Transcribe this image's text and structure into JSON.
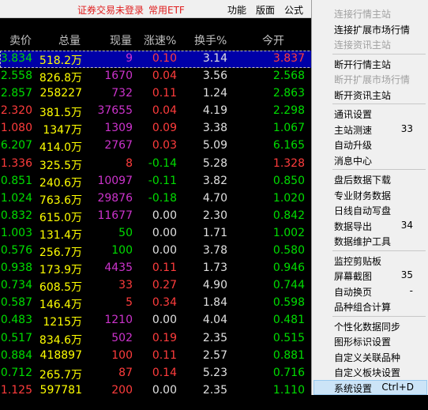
{
  "topbar": {
    "notice": "证券交易未登录",
    "etf": "常用ETF",
    "menus": [
      "功能",
      "版面",
      "公式"
    ]
  },
  "columns": [
    "卖价",
    "总量",
    "现量",
    "涨速%",
    "换手%",
    "今开"
  ],
  "rows": [
    {
      "price": "3.834",
      "vol": "518.2万",
      "now": "9",
      "spd": "0.10",
      "turn": "3.14",
      "open": "3.837",
      "pc": "down",
      "nc": "magenta",
      "sc": "up",
      "oc": "up"
    },
    {
      "price": "2.558",
      "vol": "826.8万",
      "now": "1670",
      "spd": "0.04",
      "turn": "3.56",
      "open": "2.568",
      "pc": "down",
      "nc": "magenta",
      "sc": "up",
      "oc": "down"
    },
    {
      "price": "2.857",
      "vol": "258227",
      "now": "732",
      "spd": "0.11",
      "turn": "1.24",
      "open": "2.863",
      "pc": "down",
      "nc": "magenta",
      "sc": "up",
      "oc": "down"
    },
    {
      "price": "2.320",
      "vol": "381.5万",
      "now": "37655",
      "spd": "0.04",
      "turn": "4.19",
      "open": "2.298",
      "pc": "up",
      "nc": "magenta",
      "sc": "up",
      "oc": "down"
    },
    {
      "price": "1.080",
      "vol": "1347万",
      "now": "1309",
      "spd": "0.09",
      "turn": "3.38",
      "open": "1.067",
      "pc": "up",
      "nc": "magenta",
      "sc": "up",
      "oc": "down"
    },
    {
      "price": "6.207",
      "vol": "414.0万",
      "now": "2767",
      "spd": "0.03",
      "turn": "5.09",
      "open": "6.165",
      "pc": "down",
      "nc": "magenta",
      "sc": "up",
      "oc": "down"
    },
    {
      "price": "1.336",
      "vol": "325.5万",
      "now": "8",
      "spd": "-0.14",
      "turn": "5.28",
      "open": "1.328",
      "pc": "up",
      "nc": "up",
      "sc": "down",
      "oc": "up"
    },
    {
      "price": "0.851",
      "vol": "240.6万",
      "now": "10097",
      "spd": "-0.11",
      "turn": "3.82",
      "open": "0.850",
      "pc": "down",
      "nc": "magenta",
      "sc": "down",
      "oc": "down"
    },
    {
      "price": "1.024",
      "vol": "763.6万",
      "now": "29876",
      "spd": "-0.18",
      "turn": "4.70",
      "open": "1.020",
      "pc": "down",
      "nc": "magenta",
      "sc": "down",
      "oc": "down"
    },
    {
      "price": "0.832",
      "vol": "615.0万",
      "now": "11677",
      "spd": "0.00",
      "turn": "2.30",
      "open": "0.842",
      "pc": "down",
      "nc": "magenta",
      "sc": "flat",
      "oc": "down"
    },
    {
      "price": "1.003",
      "vol": "131.4万",
      "now": "50",
      "spd": "0.00",
      "turn": "1.71",
      "open": "1.002",
      "pc": "down",
      "nc": "down",
      "sc": "flat",
      "oc": "down"
    },
    {
      "price": "0.576",
      "vol": "256.7万",
      "now": "100",
      "spd": "0.00",
      "turn": "3.78",
      "open": "0.580",
      "pc": "down",
      "nc": "down",
      "sc": "flat",
      "oc": "down"
    },
    {
      "price": "0.938",
      "vol": "173.9万",
      "now": "4435",
      "spd": "0.11",
      "turn": "1.73",
      "open": "0.946",
      "pc": "down",
      "nc": "magenta",
      "sc": "up",
      "oc": "down"
    },
    {
      "price": "0.734",
      "vol": "608.5万",
      "now": "33",
      "spd": "0.27",
      "turn": "4.90",
      "open": "0.744",
      "pc": "down",
      "nc": "up",
      "sc": "up",
      "oc": "down"
    },
    {
      "price": "0.587",
      "vol": "146.4万",
      "now": "5",
      "spd": "0.34",
      "turn": "1.84",
      "open": "0.598",
      "pc": "down",
      "nc": "up",
      "sc": "up",
      "oc": "down"
    },
    {
      "price": "0.483",
      "vol": "1215万",
      "now": "1210",
      "spd": "0.00",
      "turn": "4.04",
      "open": "0.481",
      "pc": "down",
      "nc": "magenta",
      "sc": "flat",
      "oc": "down"
    },
    {
      "price": "0.517",
      "vol": "834.6万",
      "now": "502",
      "spd": "0.19",
      "turn": "2.35",
      "open": "0.515",
      "pc": "down",
      "nc": "magenta",
      "sc": "up",
      "oc": "down"
    },
    {
      "price": "0.884",
      "vol": "418897",
      "now": "100",
      "spd": "0.11",
      "turn": "2.57",
      "open": "0.881",
      "pc": "down",
      "nc": "up",
      "sc": "up",
      "oc": "down"
    },
    {
      "price": "0.712",
      "vol": "265.7万",
      "now": "87",
      "spd": "0.14",
      "turn": "5.23",
      "open": "0.716",
      "pc": "down",
      "nc": "up",
      "sc": "up",
      "oc": "down"
    },
    {
      "price": "1.125",
      "vol": "597781",
      "now": "200",
      "spd": "0.00",
      "turn": "2.35",
      "open": "1.110",
      "pc": "up",
      "nc": "up",
      "sc": "flat",
      "oc": "down"
    }
  ],
  "context_menu": [
    {
      "label": "连接行情主站",
      "disabled": true
    },
    {
      "label": "连接扩展市场行情"
    },
    {
      "label": "连接资讯主站",
      "disabled": true
    },
    {
      "sep": true
    },
    {
      "label": "断开行情主站"
    },
    {
      "label": "断开扩展市场行情",
      "disabled": true
    },
    {
      "label": "断开资讯主站"
    },
    {
      "sep": true
    },
    {
      "label": "通讯设置"
    },
    {
      "label": "主站测速",
      "shortcut": "33"
    },
    {
      "label": "自动升级"
    },
    {
      "label": "消息中心"
    },
    {
      "sep": true
    },
    {
      "label": "盘后数据下载"
    },
    {
      "label": "专业财务数据"
    },
    {
      "label": "日线自动写盘"
    },
    {
      "label": "数据导出",
      "shortcut": "34"
    },
    {
      "label": "数据维护工具"
    },
    {
      "sep": true
    },
    {
      "label": "监控剪贴板"
    },
    {
      "label": "屏幕截图",
      "shortcut": "35"
    },
    {
      "label": "自动换页",
      "shortcut": "-"
    },
    {
      "label": "品种组合计算"
    },
    {
      "sep": true
    },
    {
      "label": "个性化数据同步"
    },
    {
      "label": "图形标识设置"
    },
    {
      "label": "自定义关联品种"
    },
    {
      "label": "自定义板块设置"
    },
    {
      "label": "系统设置",
      "shortcut": "Ctrl+D",
      "highlighted": true
    },
    {
      "label": "交易设置"
    }
  ]
}
